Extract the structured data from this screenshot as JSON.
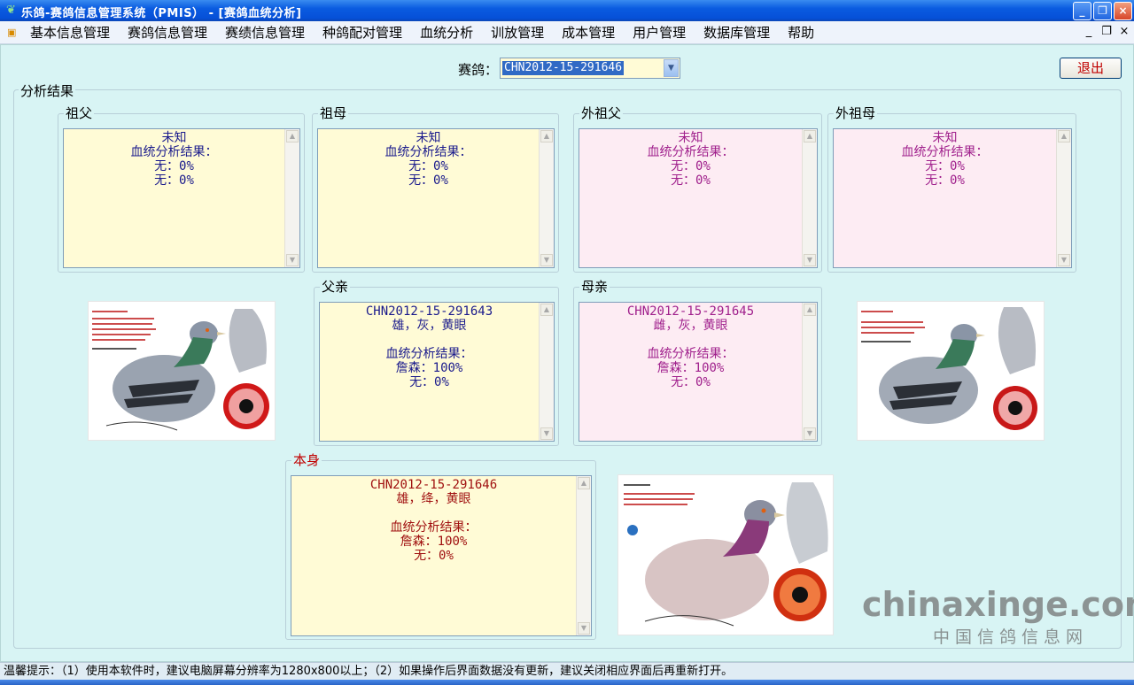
{
  "window": {
    "title": "乐鸽-赛鸽信息管理系统（PMIS） - [赛鸽血统分析]",
    "controls": [
      "_",
      "❐",
      "×"
    ]
  },
  "menu": {
    "items": [
      "基本信息管理",
      "赛鸽信息管理",
      "赛绩信息管理",
      "种鸽配对管理",
      "血统分析",
      "训放管理",
      "成本管理",
      "用户管理",
      "数据库管理",
      "帮助"
    ],
    "mdi_controls": [
      "_",
      "❐",
      "×"
    ]
  },
  "filter": {
    "label": "赛鸽：",
    "selected": "CHN2012-15-291646"
  },
  "exit_label": "退出",
  "analysis": {
    "title": "分析结果",
    "grandfather": {
      "title": "祖父",
      "text": "未知\n血统分析结果：\n无：0%\n无：0%"
    },
    "grandmother": {
      "title": "祖母",
      "text": "未知\n血统分析结果：\n无：0%\n无：0%"
    },
    "maternal_grandfather": {
      "title": "外祖父",
      "text": "未知\n血统分析结果：\n无：0%\n无：0%"
    },
    "maternal_grandmother": {
      "title": "外祖母",
      "text": "未知\n血统分析结果：\n无：0%\n无：0%"
    },
    "father": {
      "title": "父亲",
      "text": "CHN2012-15-291643\n雄，灰，黄眼\n\n血统分析结果：\n詹森：100%\n无：0%"
    },
    "mother": {
      "title": "母亲",
      "text": "CHN2012-15-291645\n雌，灰，黄眼\n\n血统分析结果：\n詹森：100%\n无：0%"
    },
    "self": {
      "title": "本身",
      "text": "CHN2012-15-291646\n雄，绛，黄眼\n\n血统分析结果：\n詹森：100%\n无：0%"
    }
  },
  "watermark": {
    "main": "chinaxinge.com",
    "sub": "中国信鸽信息网"
  },
  "status": "温馨提示：（1）使用本软件时，建议电脑屏幕分辨率为1280x800以上；（2）如果操作后界面数据没有更新，建议关闭相应界面后再重新打开。",
  "colors": {
    "client_bg": "#d8f4f4",
    "yellow_box": "#fffbd6",
    "pink_box": "#fdecf3",
    "navy_text": "#1a1a8c",
    "purple_text": "#a0208c",
    "red_text": "#a01010"
  }
}
